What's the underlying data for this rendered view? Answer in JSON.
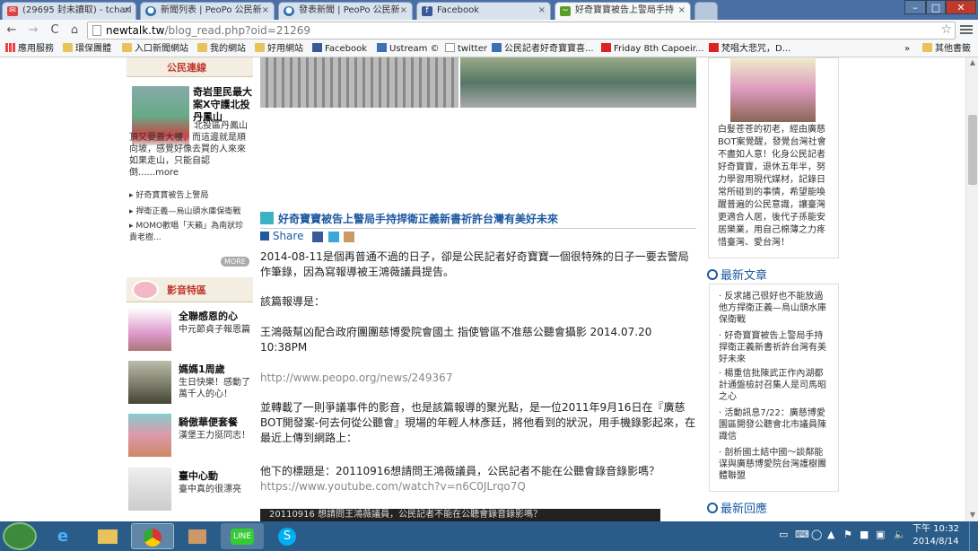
{
  "browser": {
    "tabs": [
      {
        "title": "(29695 封未讀取) - tcharl"
      },
      {
        "title": "新聞列表 | PeoPo 公民新"
      },
      {
        "title": "發表新聞 | PeoPo 公民新"
      },
      {
        "title": "Facebook"
      },
      {
        "title": "好奇寶寶被告上警局手持"
      }
    ],
    "url_host": "newtalk.tw",
    "url_path": "/blog_read.php?oid=21269",
    "bookmarks": [
      "應用服務",
      "環保團體",
      "入口新聞網站",
      "我的網站",
      "好用網站",
      "Facebook",
      "Ustream ©",
      "twitter",
      "公民記者好奇寶寶喜...",
      "Friday 8th Capoeir...",
      "梵唱大悲咒，D...",
      "其他書籤"
    ],
    "bookmarks_overflow": "»"
  },
  "left": {
    "civic_head": "公民連線",
    "feature_title": "奇岩里民最大案X守護北投丹鳳山",
    "feature_desc": "北投區丹鳳山頂又要蓋大樓，而這邊就是順向坡，感覺好像去買的人來來如果走山，只能自認倒......more",
    "links": [
      "好奇寶寶被告上警局",
      "捍衛正義—烏山頭水庫保衛戰",
      "MOMO歡唱「天籟」為南狀珍貴老樹..."
    ],
    "more": "MORE",
    "video_head": "影音特區",
    "videos": [
      {
        "title": "全聯感恩的心",
        "desc": "中元節貞子報恩篇"
      },
      {
        "title": "媽媽1周歲",
        "desc": "生日快樂！感動了萬千人的心！"
      },
      {
        "title": "騎傲華便套餐",
        "desc": "漢堡王力挺同志！"
      },
      {
        "title": "臺中心動",
        "desc": "臺中真的很漂亮"
      }
    ]
  },
  "article": {
    "title": "好奇寶寶被告上警局手持捍衛正義新書祈許台灣有美好未來",
    "share_label": "Share",
    "p1": "2014-08-11是個再普通不過的日子，卻是公民記者好奇寶寶一個很特殊的日子一要去警局作筆錄，因為寫報導被王鴻薇議員提告。",
    "p2": "該篇報導是：",
    "p3": "王鴻薇幫凶配合政府團團慈博愛院會國土 指使管區不准慈公聽會攝影 2014.07.20 10:38PM",
    "link1": "http://www.peopo.org/news/249367",
    "p4": "並轉載了一則爭議事件的影音，也是該篇報導的聚光點，是一位2011年9月16日在『廣慈BOT開發案-何去何從公聽會』現場的年輕人林彥廷，將他看到的狀況，用手機錄影起來，在最近上傳到網路上：",
    "p5": "他下的標題是：20110916想請問王鴻薇議員，公民記者不能在公聽會錄音錄影嗎？",
    "link2": "https://www.youtube.com/watch?v=n6C0JLrqo7Q",
    "video_caption": "20110916 想請問王鴻薇議員，公民記者不能在公聽會錄音錄影嗎？"
  },
  "right": {
    "bio": "白髮苍苍的初老，經由廣慈BOT案覺醒，發覺台灣社會不盡如人意！化身公民記者好奇寶寶，退休五年半，努力學習用現代媒材，記錄日常所碰到的事情，希望能喚醒普遍的公民意識，讓臺灣更適合人居，後代子孫能安居樂業，用自己棉薄之力疼惜臺灣、愛台灣！",
    "latest_head": "最新文章",
    "latest": [
      "反求諸己很好也不能放過他方捍衛正義—烏山頭水庫保衛戰",
      "好奇寶寶被告上警局手持捍衛正義新書祈許台灣有美好未來",
      "楊重信批陳武正作內湖都計通盤檢討召集人是司馬昭之心",
      "活動訊息7/22：廣慈博愛園區開發公聽會北市議員陳識信",
      "剖析國土結中國～談鄰能谋與廣慈博愛院台灣護樹團體聯盟"
    ],
    "reply_head": "最新回應"
  },
  "taskbar": {
    "time": "下午 10:32",
    "date": "2014/8/14",
    "line_label": "LINE"
  }
}
